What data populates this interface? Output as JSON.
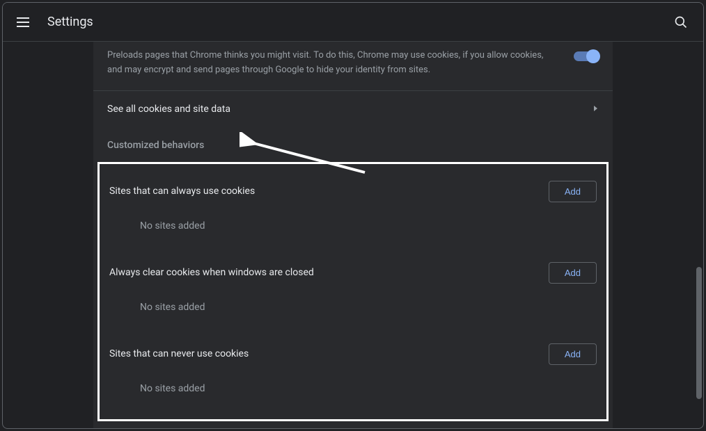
{
  "header": {
    "title": "Settings"
  },
  "preload": {
    "text": "Preloads pages that Chrome thinks you might visit. To do this, Chrome may use cookies, if you allow cookies, and may encrypt and send pages through Google to hide your identity from sites."
  },
  "cookies_link": {
    "label": "See all cookies and site data"
  },
  "behaviors": {
    "header": "Customized behaviors",
    "sections": [
      {
        "title": "Sites that can always use cookies",
        "add": "Add",
        "empty": "No sites added"
      },
      {
        "title": "Always clear cookies when windows are closed",
        "add": "Add",
        "empty": "No sites added"
      },
      {
        "title": "Sites that can never use cookies",
        "add": "Add",
        "empty": "No sites added"
      }
    ]
  }
}
